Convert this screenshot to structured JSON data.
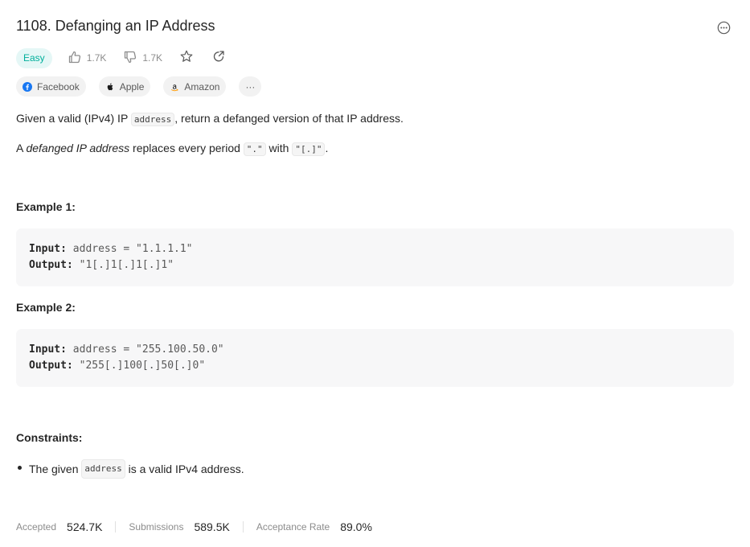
{
  "problem": {
    "title": "1108. Defanging an IP Address",
    "difficulty": "Easy",
    "likes": "1.7K",
    "dislikes": "1.7K"
  },
  "companies": [
    {
      "name": "Facebook",
      "icon": "facebook-icon"
    },
    {
      "name": "Apple",
      "icon": "apple-icon"
    },
    {
      "name": "Amazon",
      "icon": "amazon-icon"
    }
  ],
  "more_tags_label": "···",
  "description": {
    "p1_before": "Given a valid (IPv4) IP ",
    "p1_code": "address",
    "p1_after": ", return a defanged version of that IP address.",
    "p2_a": "A ",
    "p2_em": "defanged IP address",
    "p2_b": " replaces every period ",
    "p2_code1": "\".\"",
    "p2_c": " with ",
    "p2_code2": "\"[.]\"",
    "p2_d": "."
  },
  "examples": [
    {
      "heading": "Example 1:",
      "input_label": "Input:",
      "input_value": " address = \"1.1.1.1\"",
      "output_label": "Output:",
      "output_value": " \"1[.]1[.]1[.]1\""
    },
    {
      "heading": "Example 2:",
      "input_label": "Input:",
      "input_value": " address = \"255.100.50.0\"",
      "output_label": "Output:",
      "output_value": " \"255[.]100[.]50[.]0\""
    }
  ],
  "constraints": {
    "heading": "Constraints:",
    "item_before": "The given ",
    "item_code": "address",
    "item_after": " is a valid IPv4 address."
  },
  "stats": {
    "accepted_label": "Accepted",
    "accepted_value": "524.7K",
    "submissions_label": "Submissions",
    "submissions_value": "589.5K",
    "rate_label": "Acceptance Rate",
    "rate_value": "89.0%"
  },
  "colors": {
    "easy": "#00af9b",
    "easy_bg": "#e5f7f6",
    "muted": "#8c8c8c"
  }
}
